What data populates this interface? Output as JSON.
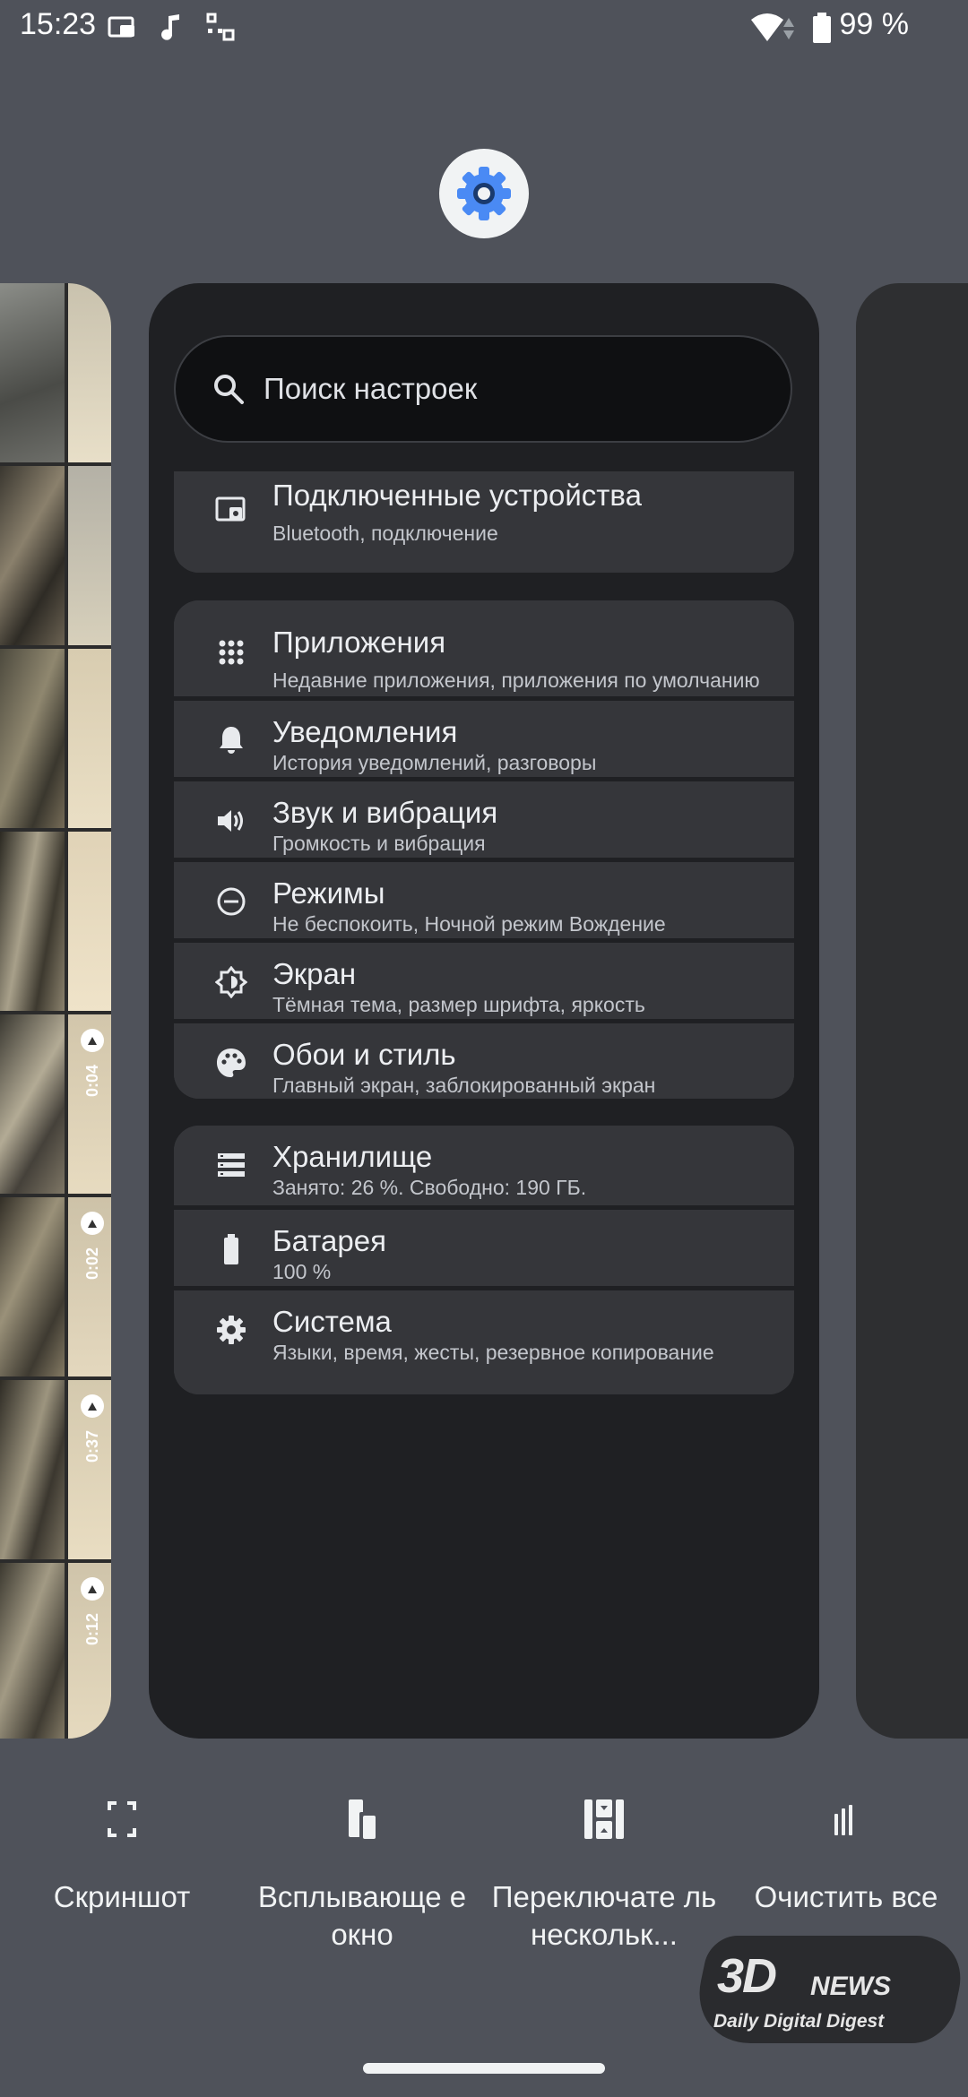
{
  "status_bar": {
    "time": "15:23",
    "battery_text": "99 %"
  },
  "search": {
    "label": "Поиск настроек"
  },
  "settings_groups": [
    [
      {
        "icon": "connected-devices-icon",
        "title": "Подключенные устройства",
        "subtitle": "Bluetooth, подключение"
      }
    ],
    [
      {
        "icon": "apps-icon",
        "title": "Приложения",
        "subtitle": "Недавние приложения, приложения по умолчанию"
      },
      {
        "icon": "bell-icon",
        "title": "Уведомления",
        "subtitle": "История уведомлений, разговоры"
      },
      {
        "icon": "speaker-icon",
        "title": "Звук и вибрация",
        "subtitle": "Громкость и вибрация"
      },
      {
        "icon": "do-not-disturb-icon",
        "title": "Режимы",
        "subtitle": "Не беспокоить, Ночной режим Вождение"
      },
      {
        "icon": "brightness-icon",
        "title": "Экран",
        "subtitle": "Тёмная тема, размер шрифта, яркость"
      },
      {
        "icon": "palette-icon",
        "title": "Обои и стиль",
        "subtitle": "Главный экран, заблокированный экран"
      }
    ],
    [
      {
        "icon": "storage-icon",
        "title": "Хранилище",
        "subtitle": "Занято: 26 %. Свободно: 190 ГБ."
      },
      {
        "icon": "battery-icon",
        "title": "Батарея",
        "subtitle": "100 %"
      },
      {
        "icon": "gear-icon",
        "title": "Система",
        "subtitle": "Языки, время, жесты, резервное копирование"
      }
    ]
  ],
  "video_durations": [
    "0:04",
    "0:02",
    "0:37",
    "0:12"
  ],
  "actions": [
    {
      "icon": "screenshot-icon",
      "label": "Скриншот"
    },
    {
      "icon": "popup-window-icon",
      "label": "Всплывающе е окно"
    },
    {
      "icon": "multi-switch-icon",
      "label": "Переключате ль нескольк..."
    },
    {
      "icon": "clear-all-icon",
      "label": "Очистить все"
    }
  ],
  "watermark": {
    "line1": "3D",
    "line2": "NEWS",
    "line3": "Daily Digital Digest"
  },
  "colors": {
    "accent_blue": "#4a8af4",
    "card_bg": "#1f2023",
    "row_bg": "#35363a",
    "page_bg": "#4f525a"
  }
}
